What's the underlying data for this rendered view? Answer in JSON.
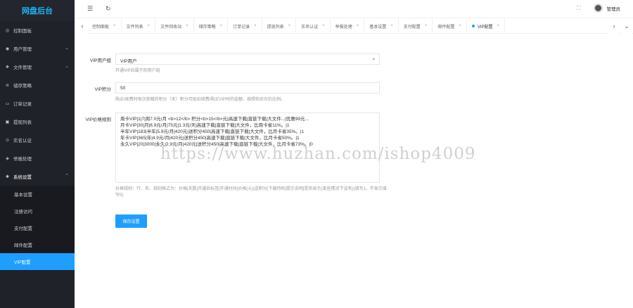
{
  "app": {
    "title": "网盘后台"
  },
  "sidebar": {
    "items": [
      {
        "label": "控制面板",
        "icon": "dashboard-icon",
        "glyph": "◎"
      },
      {
        "label": "用户管理",
        "icon": "user-icon",
        "glyph": "◉",
        "has_children": true
      },
      {
        "label": "文件管理",
        "icon": "file-icon",
        "glyph": "❖",
        "has_children": true
      },
      {
        "label": "储存策略",
        "icon": "storage-icon",
        "glyph": "≋"
      },
      {
        "label": "订单记录",
        "icon": "order-icon",
        "glyph": "▭"
      },
      {
        "label": "提现列表",
        "icon": "withdraw-icon",
        "glyph": "▣"
      },
      {
        "label": "实名认证",
        "icon": "verify-icon",
        "glyph": "⊙"
      },
      {
        "label": "举报处理",
        "icon": "report-icon",
        "glyph": "◈"
      },
      {
        "label": "系统设置",
        "icon": "settings-icon",
        "glyph": "✱",
        "has_children": true,
        "open": true
      }
    ],
    "submenu": [
      {
        "label": "基本设置"
      },
      {
        "label": "注册访问"
      },
      {
        "label": "支付配置"
      },
      {
        "label": "邮件配置"
      },
      {
        "label": "VIP配置",
        "active": true
      }
    ]
  },
  "header": {
    "admin_name": "管理员"
  },
  "tabs": [
    {
      "label": "控制面板"
    },
    {
      "label": "文件列表"
    },
    {
      "label": "文件回收站"
    },
    {
      "label": "储存策略"
    },
    {
      "label": "订单记录"
    },
    {
      "label": "提现列表"
    },
    {
      "label": "实名认证"
    },
    {
      "label": "举报处理"
    },
    {
      "label": "基本设置"
    },
    {
      "label": "支付配置"
    },
    {
      "label": "邮件配置"
    },
    {
      "label": "VIP配置",
      "active": true
    }
  ],
  "form": {
    "vip_group": {
      "label": "VIP用户组",
      "value": "VIP用户",
      "hint": "开通VIP后属于的用户组"
    },
    "vip_points": {
      "label": "VIP积分",
      "value": "50",
      "hint": "购买/续费时每次获赠的积分（天）积分可抵扣续费/购买VIP时的金额，按照你后台的比例。"
    },
    "vip_price": {
      "label": "VIP价格规则",
      "value": "周卡VIP|1|7|周7.0元/月 <b>12</b> 积分<b>15</b>元|高速下载|直链下载|大文件...|优惠99元...\n月卡VIP|30|月|6.9元/月|75元|1.3元/天|高速下载|直链下载|大文件，比周卡省11%。|1\n半年VIP|183|半年|5.9元/月|420元|送积分450|高速下载|直链下载|大文件，比月卡省35%。|1\n年卡VIP|365|年|4.9元/月|420元|送积分450|高速下载|直链下载|大文件，比月卡省50%。|1\n永久VIP|20|3000|永久|2.9元/月|420元|送积分450|高速下载|直链下载|大文件，比月卡省73%。|0",
      "hint": "价格规则：行、名、规则格式为：价格|天数|开通后标签|开通时间|价格(元)|送积分|下载特权|提示说明|是否显示(某些情况下没有)(填写1，不显示填写0)"
    },
    "submit_label": "保存设置"
  },
  "watermark": "https://www.huzhan.com/ishop4009"
}
